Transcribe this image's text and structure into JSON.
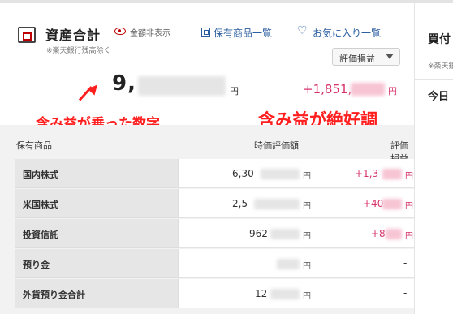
{
  "header": {
    "title": "資産合計",
    "subtitle": "※楽天銀行残高除く",
    "hide_amount": "金額非表示",
    "holdings_link": "保有商品一覧",
    "favorites_link": "お気に入り一覧",
    "sort_dropdown": "評価損益"
  },
  "summary": {
    "total_visible": "9,",
    "total_unit": "円",
    "gain_visible": "+1,851,",
    "gain_unit": "円"
  },
  "annotations": {
    "left": "含み益が乗った数字",
    "right": "含み益が絶好調"
  },
  "table": {
    "headers": {
      "name": "保有商品",
      "value": "時価評価額",
      "gain": "評価損益"
    },
    "rows": [
      {
        "name": "国内株式",
        "value": "6,30",
        "unit": "円",
        "gain": "+1,3",
        "gain_unit": "円"
      },
      {
        "name": "米国株式",
        "value": "2,5",
        "unit": "円",
        "gain": "+40",
        "gain_unit": "円"
      },
      {
        "name": "投資信託",
        "value": "962",
        "unit": "円",
        "gain": "+8",
        "gain_unit": "円"
      },
      {
        "name": "預り金",
        "value": "",
        "unit": "円",
        "gain": "-",
        "gain_unit": ""
      },
      {
        "name": "外貨預り金合計",
        "value": "12",
        "unit": "円",
        "gain": "-",
        "gain_unit": ""
      }
    ]
  },
  "right_column": {
    "title": "買付",
    "subtitle": "※楽天銀",
    "today": "今日"
  },
  "colors": {
    "accent": "#bf0000",
    "gain": "#d6336c",
    "link": "#2a5d9f",
    "annotation": "#ff1f1f"
  }
}
